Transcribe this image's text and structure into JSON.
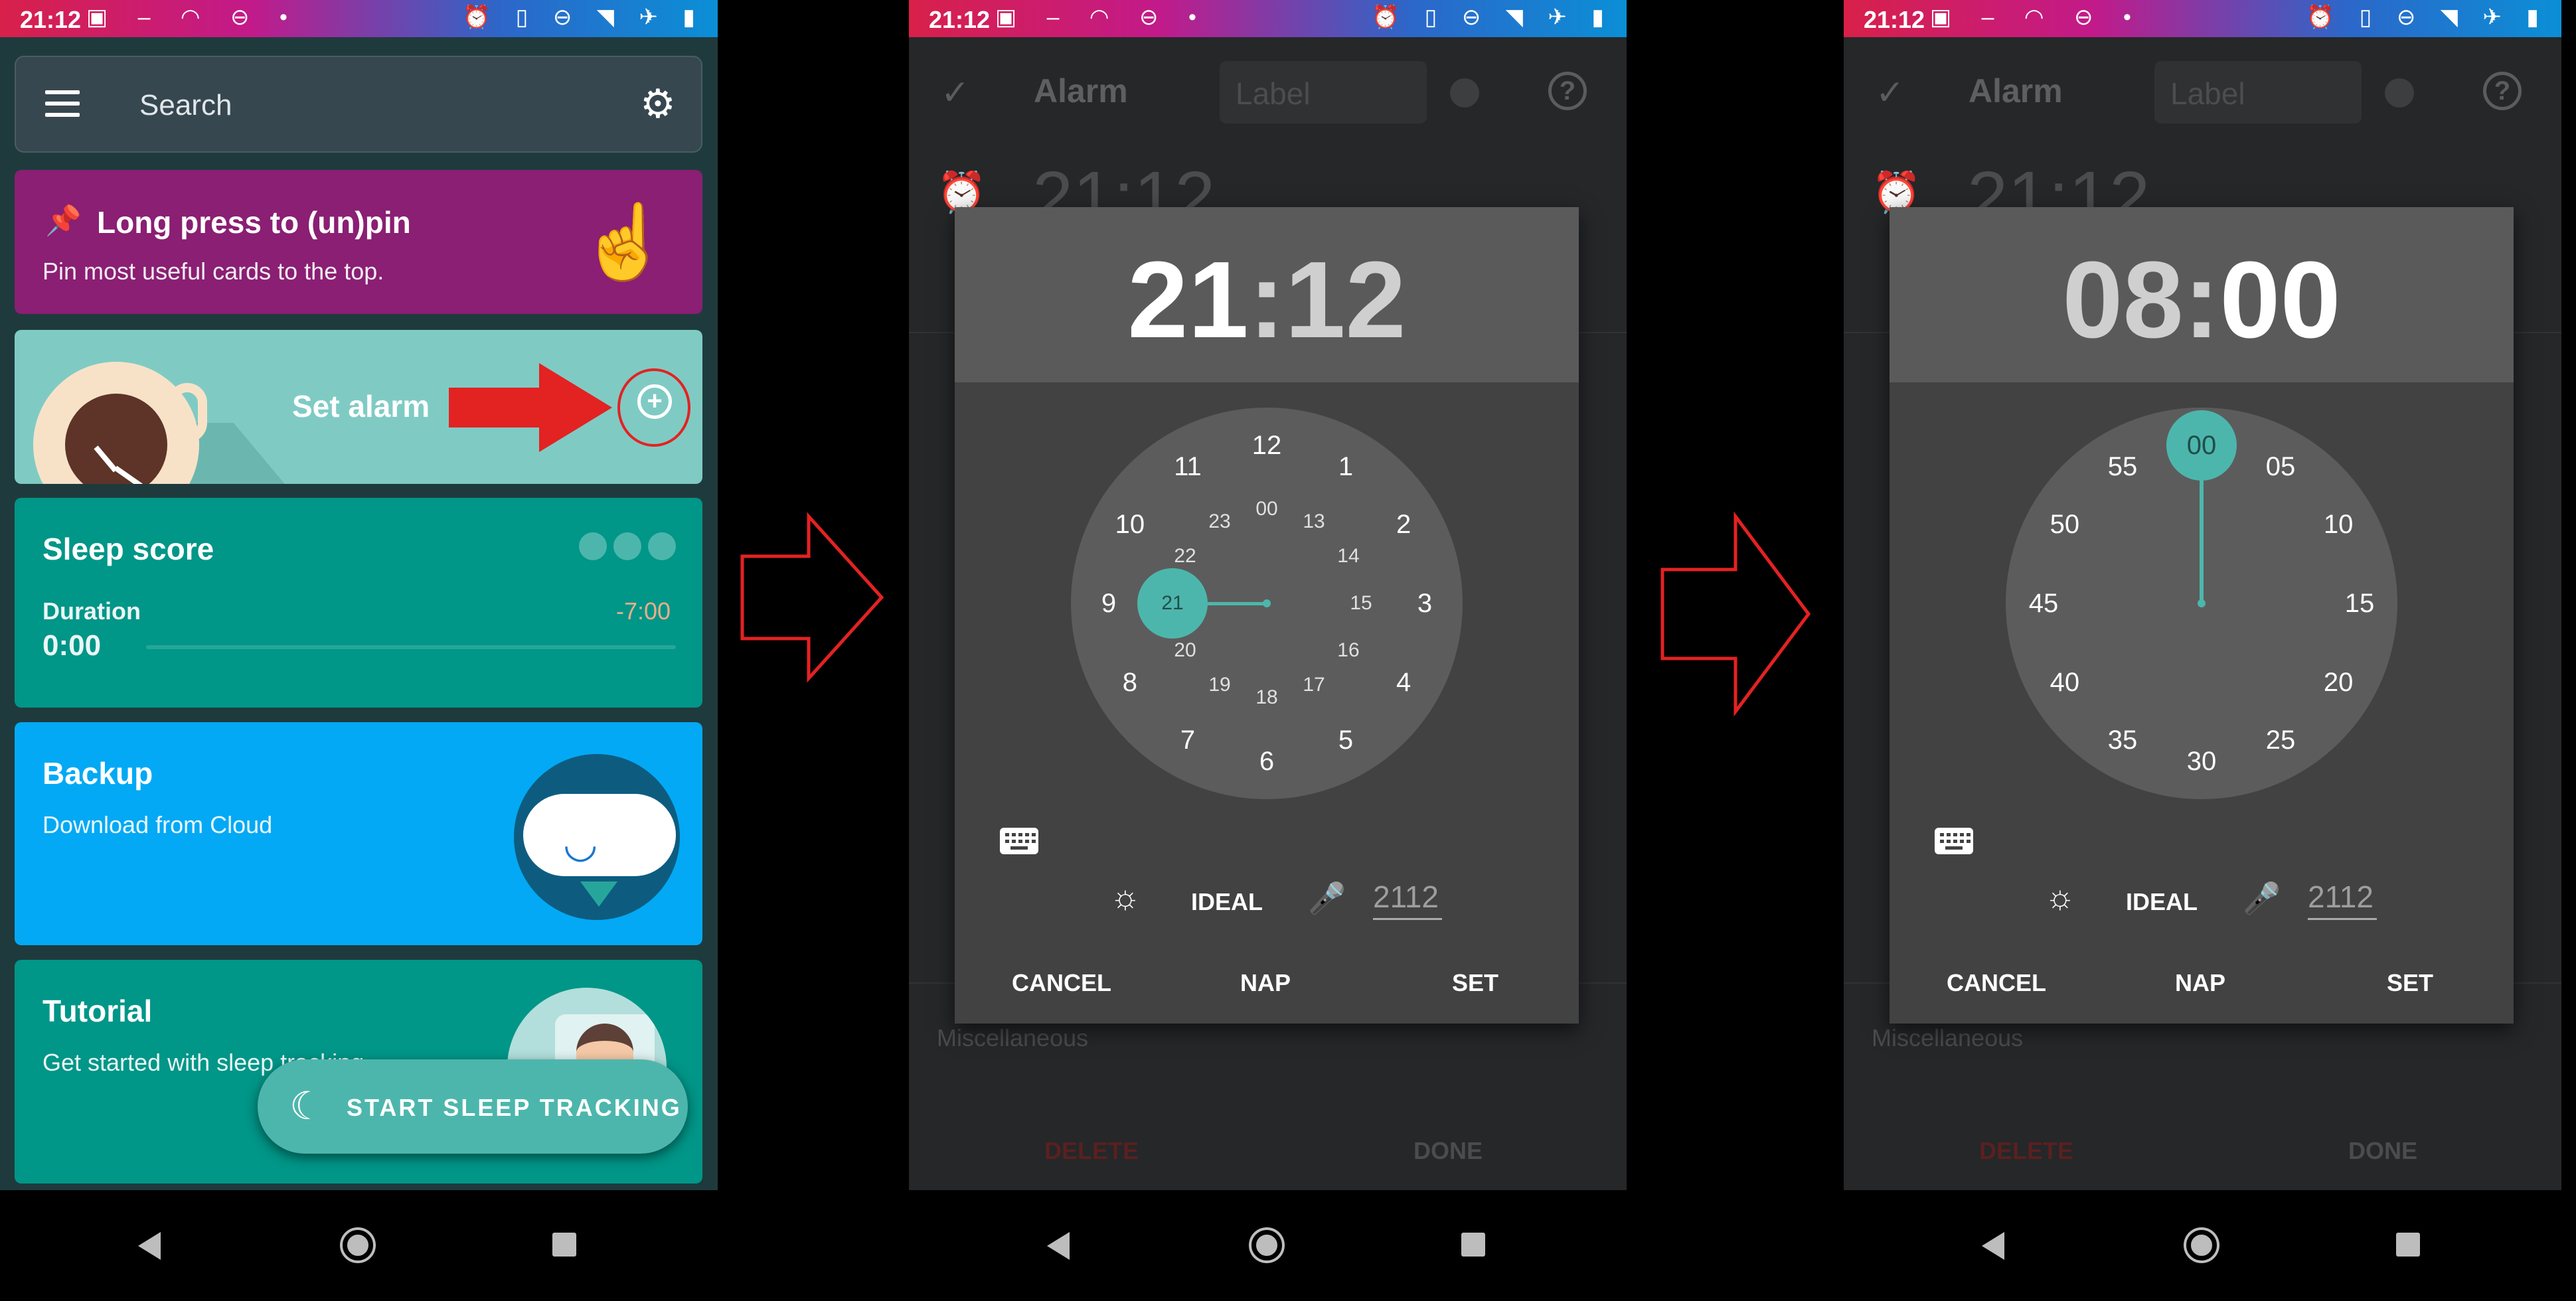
{
  "status_bar": {
    "time": "21:12"
  },
  "panel1": {
    "search": {
      "label": "Search"
    },
    "pin_card": {
      "title": "Long press to (un)pin",
      "subtitle": "Pin most useful cards to the top."
    },
    "alarm_card": {
      "label": "Set alarm"
    },
    "sleep_card": {
      "title": "Sleep score",
      "duration_label": "Duration",
      "duration_value": "0:00",
      "offset": "-7:00"
    },
    "backup_card": {
      "title": "Backup",
      "subtitle": "Download from Cloud"
    },
    "tutorial_card": {
      "title": "Tutorial",
      "subtitle": "Get started with sleep tracking"
    },
    "fab": {
      "label": "START SLEEP TRACKING"
    }
  },
  "alarm_screen": {
    "title": "Alarm",
    "label_placeholder": "Label",
    "background_time": "21:12",
    "misc_label": "Miscellaneous",
    "delete_label": "DELETE",
    "done_label": "DONE"
  },
  "panel2_dialog": {
    "time_hours": "21",
    "time_sep": ":",
    "time_minutes": "12",
    "selected": "21",
    "outer_numbers": [
      "12",
      "1",
      "2",
      "3",
      "4",
      "5",
      "6",
      "7",
      "8",
      "9",
      "10",
      "11"
    ],
    "inner_numbers": [
      "00",
      "13",
      "14",
      "15",
      "16",
      "17",
      "18",
      "19",
      "20",
      "21",
      "22",
      "23"
    ]
  },
  "panel3_dialog": {
    "time_hours": "08",
    "time_sep": ":",
    "time_minutes": "00",
    "selected": "00",
    "numbers": [
      "00",
      "05",
      "10",
      "15",
      "20",
      "25",
      "30",
      "35",
      "40",
      "45",
      "50",
      "55"
    ]
  },
  "dialog_common": {
    "ideal_label": "IDEAL",
    "code_value": "2112",
    "cancel_label": "CANCEL",
    "nap_label": "NAP",
    "set_label": "SET"
  },
  "colors": {
    "accent": "#4db6ac",
    "pin_card": "#8a1f73",
    "sleep_card": "#009688",
    "backup_card": "#03a9f4",
    "arrow": "#e32222"
  }
}
